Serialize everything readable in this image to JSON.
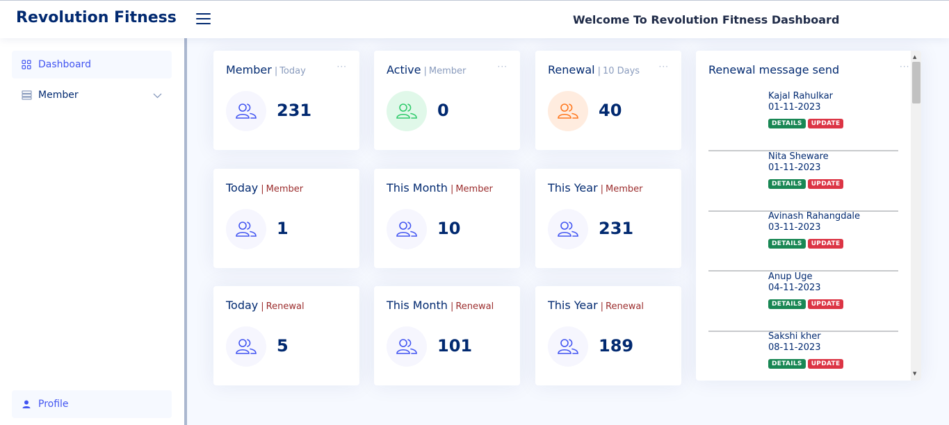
{
  "header": {
    "brand": "Revolution Fitness",
    "welcome": "Welcome To Revolution Fitness Dashboard"
  },
  "sidebar": {
    "items": [
      {
        "label": "Dashboard",
        "icon": "grid-icon",
        "active": true
      },
      {
        "label": "Member",
        "icon": "list-icon",
        "expandable": true
      }
    ],
    "profile": {
      "label": "Profile",
      "icon": "person-icon"
    }
  },
  "cards": [
    {
      "title": "Member",
      "sub": "Today",
      "value": "231",
      "icon": "people-icon"
    },
    {
      "title": "Active",
      "sub": "Member",
      "value": "0",
      "icon": "people-icon"
    },
    {
      "title": "Renewal",
      "sub": "10 Days",
      "value": "40",
      "icon": "people-icon"
    },
    {
      "title": "Today",
      "sub": "Member",
      "value": "1",
      "icon": "people-icon"
    },
    {
      "title": "This Month",
      "sub": "Member",
      "value": "10",
      "icon": "people-icon"
    },
    {
      "title": "This Year",
      "sub": "Member",
      "value": "231",
      "icon": "people-icon"
    },
    {
      "title": "Today",
      "sub": "Renewal",
      "value": "5",
      "icon": "people-icon"
    },
    {
      "title": "This Month",
      "sub": "Renewal",
      "value": "101",
      "icon": "people-icon"
    },
    {
      "title": "This Year",
      "sub": "Renewal",
      "value": "189",
      "icon": "people-icon"
    }
  ],
  "card_separator": "|",
  "card_menu": "···",
  "renewals": {
    "title": "Renewal message send",
    "details_label": "DETAILS",
    "update_label": "UPDATE",
    "items": [
      {
        "name": "Kajal Rahulkar",
        "date": "01-11-2023"
      },
      {
        "name": "Nita Sheware",
        "date": "01-11-2023"
      },
      {
        "name": "Avinash Rahangdale",
        "date": "03-11-2023"
      },
      {
        "name": "Anup Uge",
        "date": "04-11-2023"
      },
      {
        "name": "Sakshi kher",
        "date": "08-11-2023"
      }
    ]
  },
  "colors": {
    "primary": "#012970",
    "accent": "#4154f1",
    "green": "#2eca6a",
    "orange": "#ff771d",
    "details": "#198754",
    "update": "#dc3545"
  }
}
